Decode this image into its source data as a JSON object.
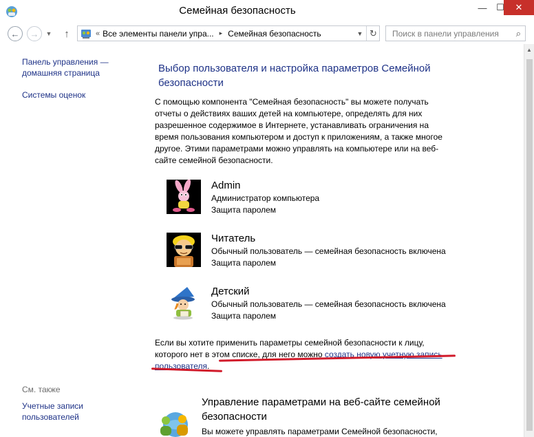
{
  "window": {
    "title": "Семейная безопасность",
    "minimize_glyph": "—",
    "maximize_glyph": "☐",
    "close_glyph": "✕"
  },
  "address_bar": {
    "overflow_chevron": "«",
    "crumbs": [
      "Все элементы панели упра...",
      "Семейная безопасность"
    ],
    "separator": "▸",
    "search_placeholder": "Поиск в панели управления"
  },
  "sidebar": {
    "home_link": "Панель управления —\nдомашняя страница",
    "ratings_link": "Системы оценок",
    "see_also_label": "См. также",
    "user_accounts_link": "Учетные записи\nпользователей"
  },
  "main": {
    "heading": "Выбор пользователя и настройка параметров Семейной безопасности",
    "intro": "С помощью компонента \"Семейная безопасность\" вы можете получать отчеты о действиях ваших детей на компьютере, определять для них разрешенное содержимое в Интернете, устанавливать ограничения на время пользования компьютером и доступ к приложениям, а также многое другое. Этими параметрами можно управлять на компьютере или на веб-сайте семейной безопасности.",
    "users": [
      {
        "name": "Admin",
        "role": "Администратор компьютера",
        "protection": "Защита паролем",
        "avatar_icon": "pink-rabbit-avatar-icon"
      },
      {
        "name": "Читатель",
        "role": "Обычный пользователь — семейная безопасность включена",
        "protection": "Защита паролем",
        "avatar_icon": "reader-sunglasses-avatar-icon"
      },
      {
        "name": "Детский",
        "role": "Обычный пользователь — семейная безопасность включена",
        "protection": "Защита паролем",
        "avatar_icon": "wizard-kid-avatar-icon"
      }
    ],
    "note_text": "Если вы хотите применить параметры семейной безопасности к лицу, которого нет в этом списке, для него можно ",
    "note_link": "создать новую учетную запись пользователя",
    "note_end": ".",
    "web_title": "Управление параметрами на веб-сайте семейной безопасности",
    "web_desc": "Вы можете управлять параметрами Семейной безопасности,"
  },
  "colors": {
    "link": "#1e3287",
    "annotation": "#d11a2a",
    "close_button": "#c7302a"
  }
}
